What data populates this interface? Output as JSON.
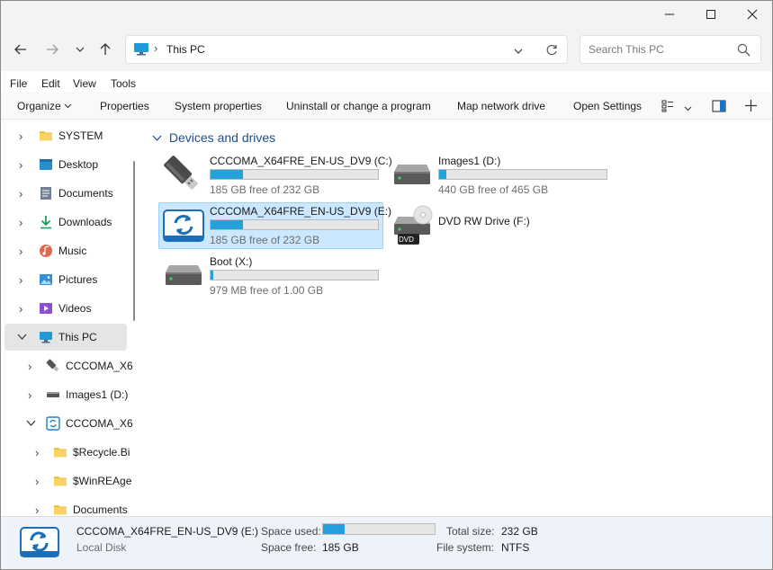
{
  "window": {
    "title": "This PC",
    "controls": [
      "minimize",
      "maximize",
      "close"
    ]
  },
  "nav": {
    "back_icon": "arrow-left-icon",
    "forward_icon": "arrow-right-icon",
    "recent_icon": "chevron-down-icon",
    "up_icon": "arrow-up-icon",
    "address": "This PC",
    "address_icon": "monitor-icon",
    "search_placeholder": "Search This PC"
  },
  "menu": [
    "File",
    "Edit",
    "View",
    "Tools"
  ],
  "commands": {
    "organize": "Organize",
    "properties": "Properties",
    "system_properties": "System properties",
    "uninstall": "Uninstall or change a program",
    "map_drive": "Map network drive",
    "open_settings": "Open Settings"
  },
  "sidebar": {
    "items": [
      {
        "label": "SYSTEM",
        "icon": "folder-icon",
        "expanded": false
      },
      {
        "label": "Desktop",
        "icon": "desktop-icon",
        "expanded": false
      },
      {
        "label": "Documents",
        "icon": "documents-icon",
        "expanded": false
      },
      {
        "label": "Downloads",
        "icon": "download-icon",
        "expanded": false
      },
      {
        "label": "Music",
        "icon": "music-icon",
        "expanded": false
      },
      {
        "label": "Pictures",
        "icon": "pictures-icon",
        "expanded": false
      },
      {
        "label": "Videos",
        "icon": "videos-icon",
        "expanded": false
      },
      {
        "label": "This PC",
        "icon": "monitor-icon",
        "expanded": true,
        "selected": true
      },
      {
        "label": "CCCOMA_X6",
        "icon": "usb-drive-icon",
        "expanded": false
      },
      {
        "label": "Images1 (D:)",
        "icon": "hard-drive-icon",
        "expanded": false
      },
      {
        "label": "CCCOMA_X6",
        "icon": "setup-drive-icon",
        "expanded": true
      },
      {
        "label": "$Recycle.Bi",
        "icon": "folder-icon",
        "expanded": false
      },
      {
        "label": "$WinREAge",
        "icon": "folder-icon",
        "expanded": false
      },
      {
        "label": "Documents",
        "icon": "folder-icon",
        "expanded": false
      }
    ]
  },
  "content": {
    "group_title": "Devices and drives",
    "drives": [
      {
        "name": "CCCOMA_X64FRE_EN-US_DV9 (C:)",
        "free": "185 GB free of 232 GB",
        "used_fraction": 0.2,
        "icon": "usb-drive-icon"
      },
      {
        "name": "Images1 (D:)",
        "free": "440 GB free of 465 GB",
        "used_fraction": 0.05,
        "icon": "hard-drive-icon"
      },
      {
        "name": "CCCOMA_X64FRE_EN-US_DV9 (E:)",
        "free": "185 GB free of 232 GB",
        "used_fraction": 0.2,
        "icon": "setup-drive-icon",
        "selected": true
      },
      {
        "name": "DVD RW Drive (F:)",
        "free": "",
        "icon": "dvd-drive-icon",
        "badge": "DVD"
      },
      {
        "name": "Boot (X:)",
        "free": "979 MB free of 1.00 GB",
        "used_fraction": 0.02,
        "icon": "hard-drive-icon"
      }
    ]
  },
  "status": {
    "name": "CCCOMA_X64FRE_EN-US_DV9 (E:)",
    "type": "Local Disk",
    "space_used_label": "Space used:",
    "space_used_fraction": 0.2,
    "space_free_label": "Space free:",
    "space_free": "185 GB",
    "total_size_label": "Total size:",
    "total_size": "232 GB",
    "file_system_label": "File system:",
    "file_system": "NTFS"
  },
  "colors": {
    "accent": "#26a0da",
    "selection": "#cce8ff",
    "header_blue": "#1f4e8c"
  }
}
